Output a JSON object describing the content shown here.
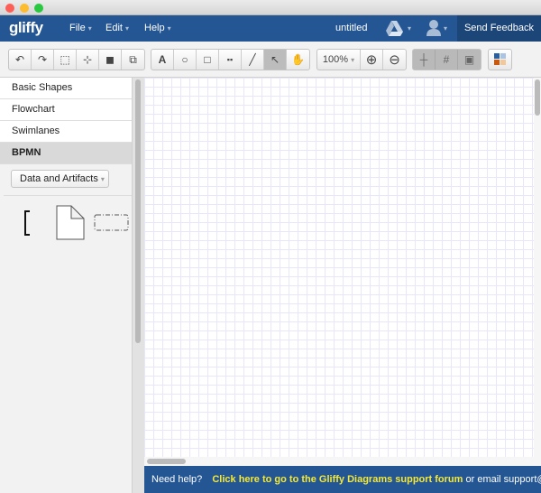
{
  "window": {
    "controls": [
      "close",
      "minimize",
      "maximize"
    ]
  },
  "header": {
    "logo": "gliffy",
    "menus": [
      {
        "label": "File"
      },
      {
        "label": "Edit"
      },
      {
        "label": "Help"
      }
    ],
    "doc_title": "untitled",
    "feedback": "Send Feedback",
    "caret": "▾"
  },
  "toolbar": {
    "zoom": "100%"
  },
  "sidebar": {
    "categories": [
      "Basic Shapes",
      "Flowchart",
      "Swimlanes",
      "BPMN"
    ],
    "selected": "BPMN",
    "dropdown": "Data and Artifacts"
  },
  "footer": {
    "need_help": "Need help?",
    "link": "Click here to go to the Gliffy Diagrams support forum",
    "email_text": "or email support@gliffy.com"
  },
  "colors": {
    "header": "#245694",
    "footer_link": "#f4e83a"
  }
}
